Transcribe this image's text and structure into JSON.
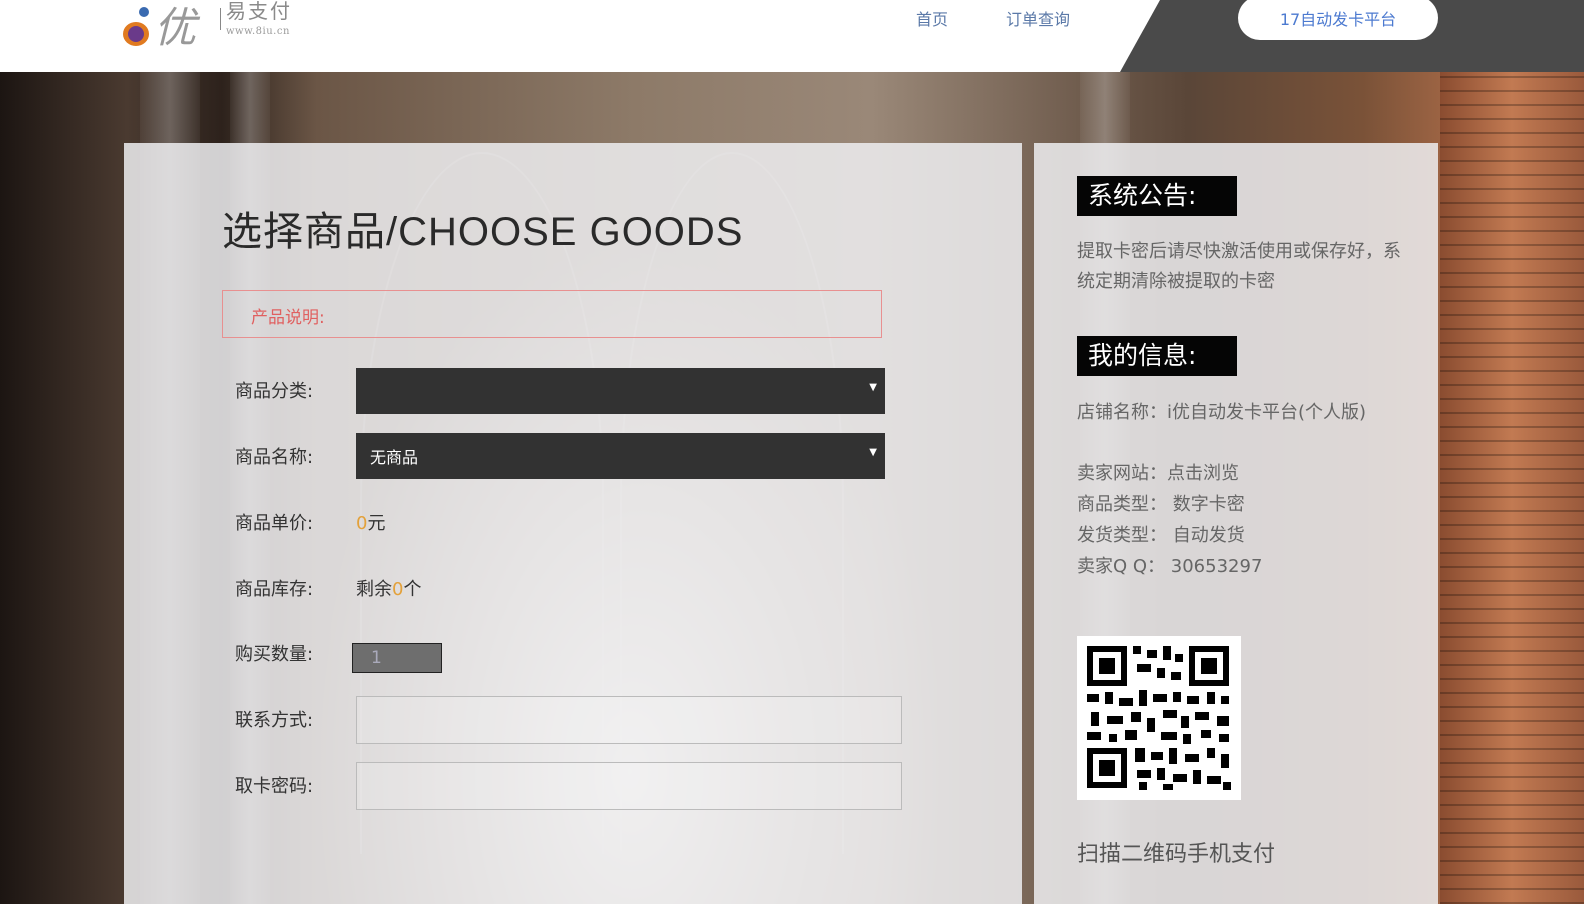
{
  "header": {
    "logo_text": "易支付",
    "logo_url": "www.8iu.cn",
    "nav": [
      {
        "label": "首页"
      },
      {
        "label": "订单查询"
      }
    ],
    "platform_button": "17自动发卡平台"
  },
  "main": {
    "title": "选择商品/CHOOSE GOODS",
    "description_label": "产品说明:",
    "fields": {
      "category_label": "商品分类:",
      "category_value": "",
      "name_label": "商品名称:",
      "name_value": "无商品",
      "price_label": "商品单价:",
      "price_amount": "0",
      "price_unit": "元",
      "stock_label": "商品库存:",
      "stock_prefix": "剩余",
      "stock_amount": "0",
      "stock_suffix": "个",
      "quantity_label": "购买数量:",
      "quantity_value": "1",
      "contact_label": "联系方式:",
      "contact_value": "",
      "password_label": "取卡密码:",
      "password_value": ""
    }
  },
  "side": {
    "notice_heading": "系统公告:",
    "notice_text": "提取卡密后请尽快激活使用或保存好，系统定期清除被提取的卡密",
    "info_heading": "我的信息:",
    "info": [
      "店铺名称：i优自动发卡平台(个人版)",
      "卖家网站：点击浏览",
      "商品类型：  数字卡密",
      "发货类型：  自动发货",
      "卖家Q Q：  30653297"
    ],
    "qr_caption": "扫描二维码手机支付"
  },
  "colors": {
    "accent_orange": "#e3a13a",
    "description_red": "#e06060",
    "nav_blue": "#5b79a8",
    "dark_select": "#323232"
  }
}
